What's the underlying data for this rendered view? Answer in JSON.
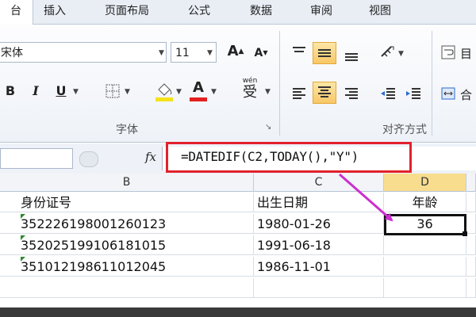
{
  "tabs": [
    {
      "label": "台",
      "active": true
    },
    {
      "label": "插入"
    },
    {
      "label": "页面布局"
    },
    {
      "label": "公式"
    },
    {
      "label": "数据"
    },
    {
      "label": "审阅"
    },
    {
      "label": "视图"
    }
  ],
  "ribbon": {
    "font_name": "宋体",
    "font_size": "11",
    "grow_font": "A",
    "shrink_font": "A",
    "bold": "B",
    "italic": "I",
    "underline": "U",
    "font_color": "A",
    "phonetic": "wén",
    "phonetic_char": "受",
    "group_font": "字体",
    "group_align": "对齐方式",
    "wrap_icon_label": "目",
    "merge_icon_label": "合"
  },
  "formula_bar": {
    "fx": "fx",
    "formula": "=DATEDIF(C2,TODAY(),\"Y\")"
  },
  "columns": [
    {
      "label": "B"
    },
    {
      "label": "C"
    },
    {
      "label": "D",
      "selected": true
    }
  ],
  "rows": [
    {
      "b": "身份证号",
      "c": "出生日期",
      "d": "年龄"
    },
    {
      "b": "352226198001260123",
      "c": "1980-01-26",
      "d": "36"
    },
    {
      "b": "352025199106181015",
      "c": "1991-06-18",
      "d": ""
    },
    {
      "b": "351012198611012045",
      "c": "1986-11-01",
      "d": ""
    }
  ],
  "colors": {
    "highlight_border": "#e2212b",
    "arrow": "#cc2fd0",
    "error_triangle": "#2f8a2f",
    "selected_col": "#f8dd8f"
  }
}
